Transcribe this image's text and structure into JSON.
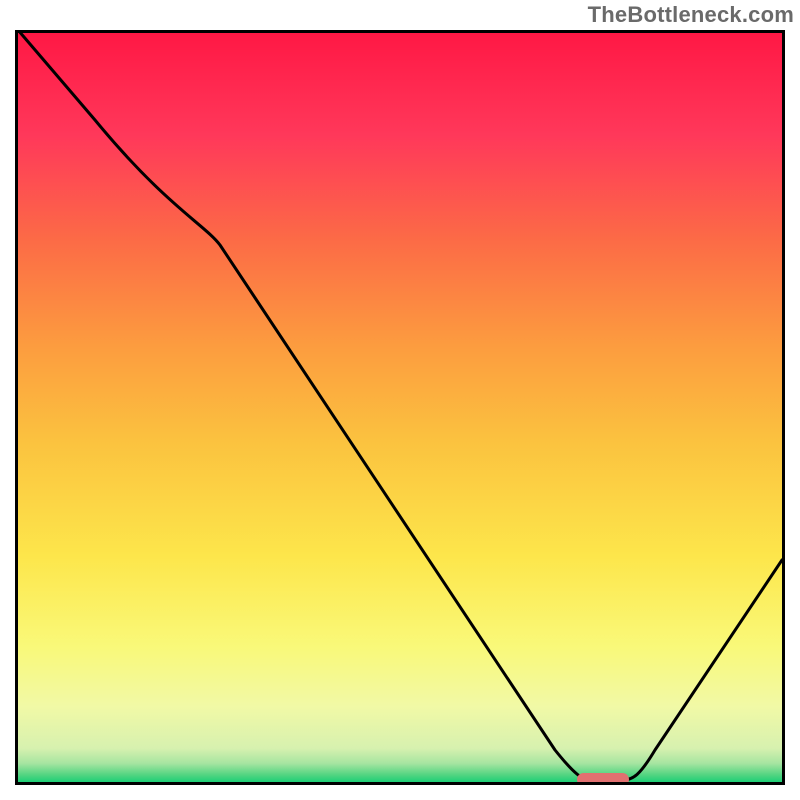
{
  "watermark": {
    "text": "TheBottleneck.com"
  },
  "chart_data": {
    "type": "line",
    "title": "",
    "xlabel": "",
    "ylabel": "",
    "xlim": [
      0,
      100
    ],
    "ylim": [
      0,
      100
    ],
    "grid": false,
    "legend": false,
    "series": [
      {
        "name": "curve",
        "x": [
          0,
          10,
          25,
          45,
          60,
          70,
          74,
          78,
          82,
          100
        ],
        "y": [
          100,
          88,
          75,
          46,
          24,
          6,
          0,
          0,
          3,
          30
        ]
      }
    ],
    "marker": {
      "name": "optimal-zone",
      "x_range": [
        73,
        79
      ],
      "y": 0,
      "color": "#e27070"
    },
    "background": {
      "type": "vertical-gradient",
      "stops": [
        {
          "pos": 0.0,
          "color": "#ff1744"
        },
        {
          "pos": 0.14,
          "color": "#ff385a"
        },
        {
          "pos": 0.28,
          "color": "#fc6b46"
        },
        {
          "pos": 0.42,
          "color": "#fc9c3f"
        },
        {
          "pos": 0.55,
          "color": "#fbc33f"
        },
        {
          "pos": 0.7,
          "color": "#fde64b"
        },
        {
          "pos": 0.82,
          "color": "#f9f979"
        },
        {
          "pos": 0.9,
          "color": "#f1f9a6"
        },
        {
          "pos": 0.955,
          "color": "#d7f1af"
        },
        {
          "pos": 0.975,
          "color": "#a7e5a1"
        },
        {
          "pos": 0.99,
          "color": "#55d582"
        },
        {
          "pos": 1.0,
          "color": "#1dcf76"
        }
      ]
    }
  }
}
